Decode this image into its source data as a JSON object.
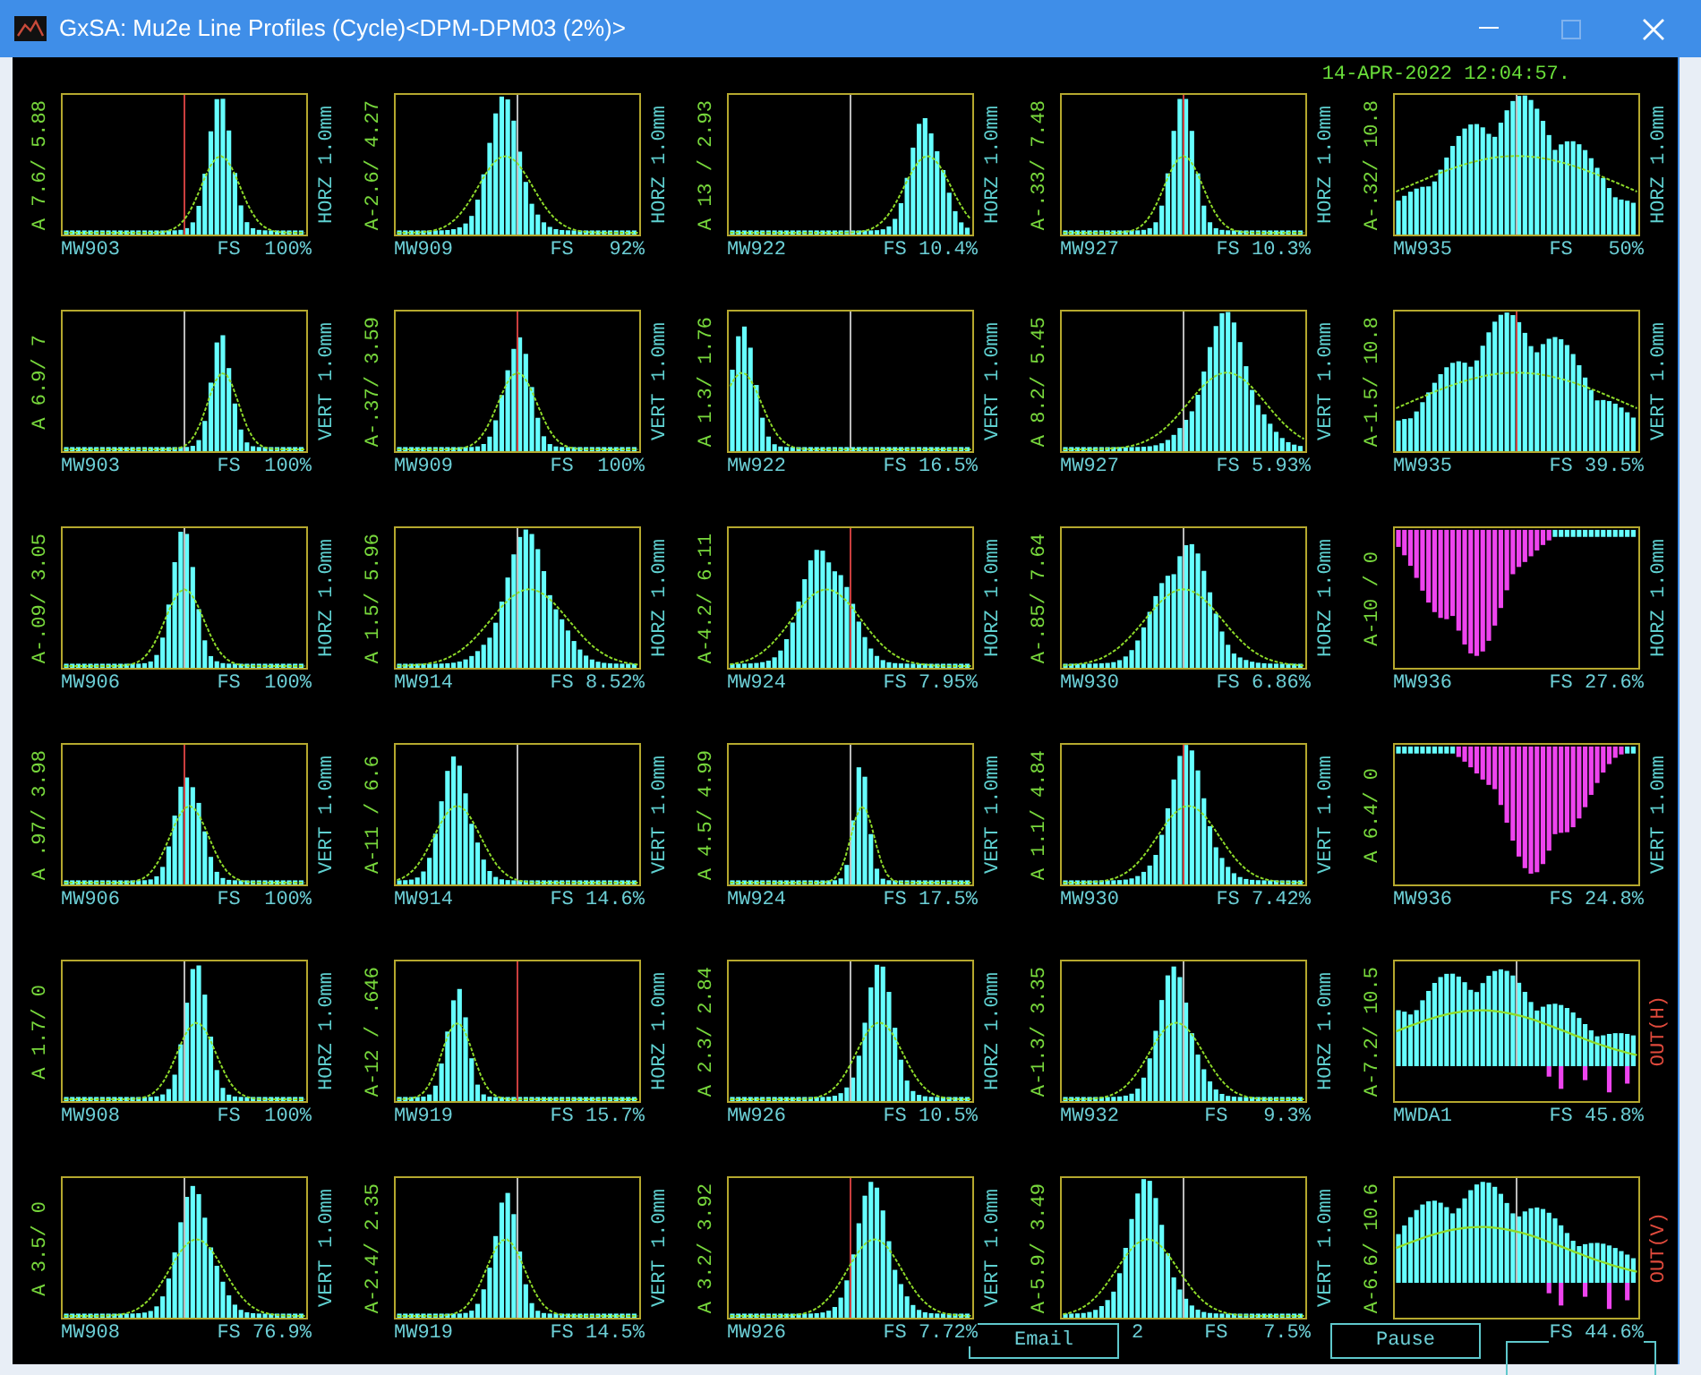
{
  "window": {
    "title": "GxSA: Mu2e Line Profiles (Cycle)<DPM-DPM03 (2%)>"
  },
  "timestamp": "14-APR-2022 12:04:57.",
  "panels": [
    {
      "range": "A 7.6/ 5.88",
      "axis": "HORZ 1.0mm",
      "alarm": false,
      "name": "MW903",
      "name_covered": false,
      "scale": "FS  100%",
      "kind": "peak"
    },
    {
      "range": "A-2.6/ 4.27",
      "axis": "HORZ 1.0mm",
      "alarm": false,
      "name": "MW909",
      "name_covered": false,
      "scale": "FS   92%",
      "kind": "peak"
    },
    {
      "range": "A 13 / 2.93",
      "axis": "HORZ 1.0mm",
      "alarm": false,
      "name": "MW922",
      "name_covered": false,
      "scale": "FS 10.4%",
      "kind": "peak"
    },
    {
      "range": "A-.33/ 7.48",
      "axis": "HORZ 1.0mm",
      "alarm": false,
      "name": "MW927",
      "name_covered": false,
      "scale": "FS 10.3%",
      "kind": "peak"
    },
    {
      "range": "A-.32/ 10.8",
      "axis": "HORZ 1.0mm",
      "alarm": false,
      "name": "MW935",
      "name_covered": false,
      "scale": "FS   50%",
      "kind": "peak"
    },
    {
      "range": "A 6.9/ 7",
      "axis": "VERT 1.0mm",
      "alarm": false,
      "name": "MW903",
      "name_covered": false,
      "scale": "FS  100%",
      "kind": "peak"
    },
    {
      "range": "A-.37/ 3.59",
      "axis": "VERT 1.0mm",
      "alarm": false,
      "name": "MW909",
      "name_covered": false,
      "scale": "FS  100%",
      "kind": "peak"
    },
    {
      "range": "A 1.3/ 1.76",
      "axis": "VERT 1.0mm",
      "alarm": false,
      "name": "MW922",
      "name_covered": false,
      "scale": "FS 16.5%",
      "kind": "peak"
    },
    {
      "range": "A 8.2/ 5.45",
      "axis": "VERT 1.0mm",
      "alarm": false,
      "name": "MW927",
      "name_covered": false,
      "scale": "FS 5.93%",
      "kind": "peak"
    },
    {
      "range": "A-1.5/ 10.8",
      "axis": "VERT 1.0mm",
      "alarm": false,
      "name": "MW935",
      "name_covered": false,
      "scale": "FS 39.5%",
      "kind": "peak"
    },
    {
      "range": "A-.09/ 3.05",
      "axis": "HORZ 1.0mm",
      "alarm": false,
      "name": "MW906",
      "name_covered": false,
      "scale": "FS  100%",
      "kind": "peak"
    },
    {
      "range": "A 1.5/ 5.96",
      "axis": "HORZ 1.0mm",
      "alarm": false,
      "name": "MW914",
      "name_covered": false,
      "scale": "FS 8.52%",
      "kind": "peak"
    },
    {
      "range": "A-4.2/ 6.11",
      "axis": "HORZ 1.0mm",
      "alarm": false,
      "name": "MW924",
      "name_covered": false,
      "scale": "FS 7.95%",
      "kind": "peak"
    },
    {
      "range": "A-.85/ 7.64",
      "axis": "HORZ 1.0mm",
      "alarm": false,
      "name": "MW930",
      "name_covered": false,
      "scale": "FS 6.86%",
      "kind": "peak"
    },
    {
      "range": "A-10 / 0",
      "axis": "HORZ 1.0mm",
      "alarm": false,
      "name": "MW936",
      "name_covered": false,
      "scale": "FS 27.6%",
      "kind": "dip"
    },
    {
      "range": "A .97/ 3.98",
      "axis": "VERT 1.0mm",
      "alarm": false,
      "name": "MW906",
      "name_covered": false,
      "scale": "FS  100%",
      "kind": "peak"
    },
    {
      "range": "A-11 / 6.6",
      "axis": "VERT 1.0mm",
      "alarm": false,
      "name": "MW914",
      "name_covered": false,
      "scale": "FS 14.6%",
      "kind": "peak"
    },
    {
      "range": "A 4.5/ 4.99",
      "axis": "VERT 1.0mm",
      "alarm": false,
      "name": "MW924",
      "name_covered": false,
      "scale": "FS 17.5%",
      "kind": "peak"
    },
    {
      "range": "A 1.1/ 4.84",
      "axis": "VERT 1.0mm",
      "alarm": false,
      "name": "MW930",
      "name_covered": false,
      "scale": "FS 7.42%",
      "kind": "peak"
    },
    {
      "range": "A 6.4/ 0",
      "axis": "VERT 1.0mm",
      "alarm": false,
      "name": "MW936",
      "name_covered": false,
      "scale": "FS 24.8%",
      "kind": "dip"
    },
    {
      "range": "A 1.7/ 0",
      "axis": "HORZ 1.0mm",
      "alarm": false,
      "name": "MW908",
      "name_covered": false,
      "scale": "FS  100%",
      "kind": "peak"
    },
    {
      "range": "A-12 / .646",
      "axis": "HORZ 1.0mm",
      "alarm": false,
      "name": "MW919",
      "name_covered": false,
      "scale": "FS 15.7%",
      "kind": "peak"
    },
    {
      "range": "A 2.3/ 2.84",
      "axis": "HORZ 1.0mm",
      "alarm": false,
      "name": "MW926",
      "name_covered": false,
      "scale": "FS 10.5%",
      "kind": "peak"
    },
    {
      "range": "A-1.3/ 3.35",
      "axis": "HORZ 1.0mm",
      "alarm": false,
      "name": "MW932",
      "name_covered": false,
      "scale": "FS   9.3%",
      "kind": "peak"
    },
    {
      "range": "A-7.2/ 10.5",
      "axis": "OUT(H)",
      "alarm": true,
      "name": "MWDA1",
      "name_covered": false,
      "scale": "FS 45.8%",
      "kind": "mixed"
    },
    {
      "range": "A 3.5/ 0",
      "axis": "VERT 1.0mm",
      "alarm": false,
      "name": "MW908",
      "name_covered": false,
      "scale": "FS 76.9%",
      "kind": "peak"
    },
    {
      "range": "A-2.4/ 2.35",
      "axis": "VERT 1.0mm",
      "alarm": false,
      "name": "MW919",
      "name_covered": false,
      "scale": "FS 14.5%",
      "kind": "peak"
    },
    {
      "range": "A 3.2/ 3.92",
      "axis": "VERT 1.0mm",
      "alarm": false,
      "name": "MW926",
      "name_covered": false,
      "scale": "FS 7.72%",
      "kind": "peak"
    },
    {
      "range": "A-5.9/ 3.49",
      "axis": "VERT 1.0mm",
      "alarm": false,
      "name": "2",
      "name_covered": true,
      "scale": "FS   7.5%",
      "kind": "peak"
    },
    {
      "range": "A-6.6/ 10.6",
      "axis": "OUT(V)",
      "alarm": true,
      "name_covered": false,
      "scale": "FS 44.6%",
      "kind": "mixed"
    }
  ],
  "buttons": [
    {
      "label": "Email",
      "kind": "email"
    },
    {
      "label": "Pause",
      "kind": "pause"
    },
    {
      "kind": "zoom"
    }
  ]
}
